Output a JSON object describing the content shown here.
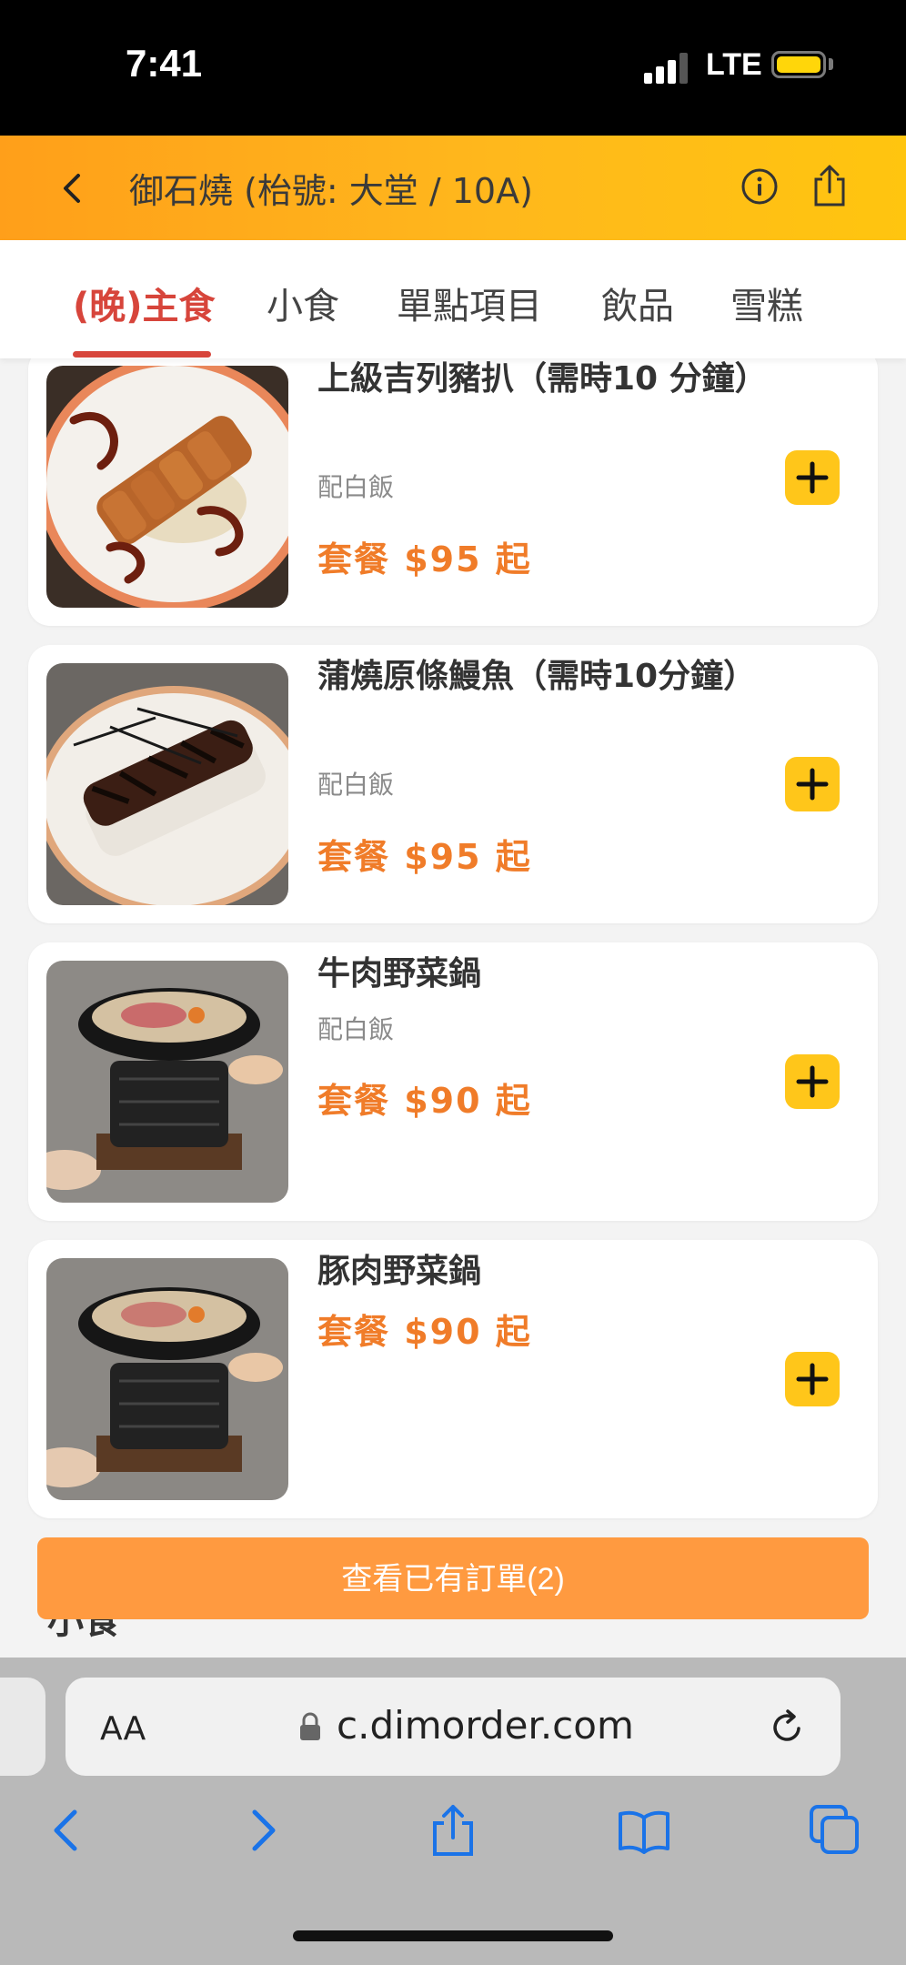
{
  "status_bar": {
    "time": "7:41",
    "network": "LTE"
  },
  "header": {
    "title": "御石燒 (枱號: 大堂 / 10A)"
  },
  "tabs": [
    {
      "label": "(晚)主食",
      "active": true
    },
    {
      "label": "小食"
    },
    {
      "label": "單點項目"
    },
    {
      "label": "飲品"
    },
    {
      "label": "雪糕"
    }
  ],
  "items": [
    {
      "name": "上級吉列豬扒（需時10 分鐘）",
      "note": "配白飯",
      "price": "套餐 $95 起"
    },
    {
      "name": "蒲燒原條鰻魚（需時10分鐘）",
      "note": "配白飯",
      "price": "套餐 $95 起"
    },
    {
      "name": "牛肉野菜鍋",
      "note": "配白飯",
      "price": "套餐 $90 起"
    },
    {
      "name": "豚肉野菜鍋",
      "note": "",
      "price": "套餐 $90 起"
    }
  ],
  "next_section": "小食",
  "view_orders_label": "查看已有訂單(2)",
  "browser": {
    "aa": "AA",
    "url": "c.dimorder.com"
  },
  "colors": {
    "accent": "#d7453b",
    "price": "#f07c29",
    "add_button": "#ffc61a",
    "order_button": "#ff9a40",
    "header_start": "#ff9f1a",
    "header_end": "#ffc50f"
  }
}
